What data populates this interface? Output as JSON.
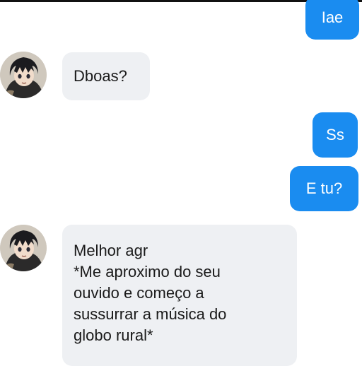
{
  "colors": {
    "outgoing_bubble": "#1a8cf0",
    "incoming_bubble": "#eef0f3",
    "outgoing_text": "#ffffff",
    "incoming_text": "#1a1a1a"
  },
  "messages": [
    {
      "direction": "outgoing",
      "text": "Iae"
    },
    {
      "direction": "incoming",
      "text": "Dboas?",
      "avatar": "anime-character-avatar"
    },
    {
      "direction": "outgoing",
      "text": "Ss"
    },
    {
      "direction": "outgoing",
      "text": "E tu?"
    },
    {
      "direction": "incoming",
      "avatar": "anime-character-avatar",
      "lines": [
        "Melhor agr",
        "*Me aproximo do seu",
        "ouvido e começo a",
        "sussurrar a música do",
        "globo rural*"
      ]
    }
  ]
}
